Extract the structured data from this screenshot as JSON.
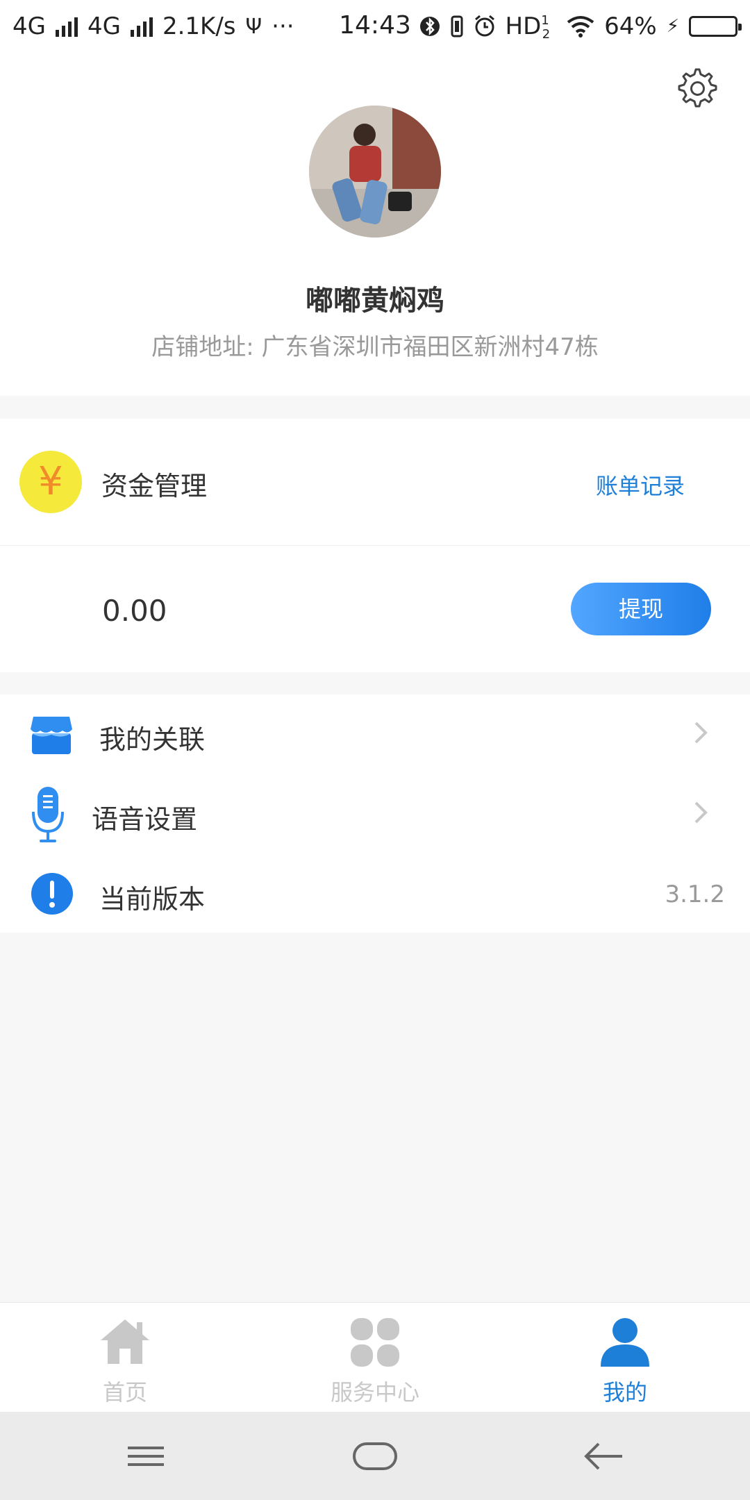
{
  "status_bar": {
    "net1": "4G",
    "net2": "4G",
    "speed": "2.1K/s",
    "usb": "Ψ",
    "more": "···",
    "time": "14:43",
    "hd": "HD",
    "hd_sup": "1",
    "hd_sub": "2",
    "battery_pct": "64%",
    "battery_level": 0.64,
    "charging": "⚡"
  },
  "profile": {
    "settings_icon": "gear-icon",
    "name": "嘟嘟黄焖鸡",
    "address": "店铺地址: 广东省深圳市福田区新洲村47栋"
  },
  "funds": {
    "icon": "yen-icon",
    "icon_glyph": "¥",
    "title": "资金管理",
    "bill_link": "账单记录",
    "balance": "0.00",
    "withdraw_label": "提现"
  },
  "menu": {
    "items": [
      {
        "label": "我的关联",
        "icon": "store-icon"
      },
      {
        "label": "语音设置",
        "icon": "microphone-icon"
      },
      {
        "label": "当前版本",
        "icon": "info-icon",
        "value": "3.1.2"
      }
    ]
  },
  "bottom_nav": {
    "items": [
      {
        "label": "首页",
        "icon": "home-icon"
      },
      {
        "label": "服务中心",
        "icon": "grid-icon"
      },
      {
        "label": "我的",
        "icon": "user-icon",
        "active": true
      }
    ]
  },
  "colors": {
    "accent": "#1e7fd8",
    "yen_bg": "#f5e93b",
    "yen_fg": "#f08a2a",
    "inactive_nav": "#c8c8c8"
  }
}
